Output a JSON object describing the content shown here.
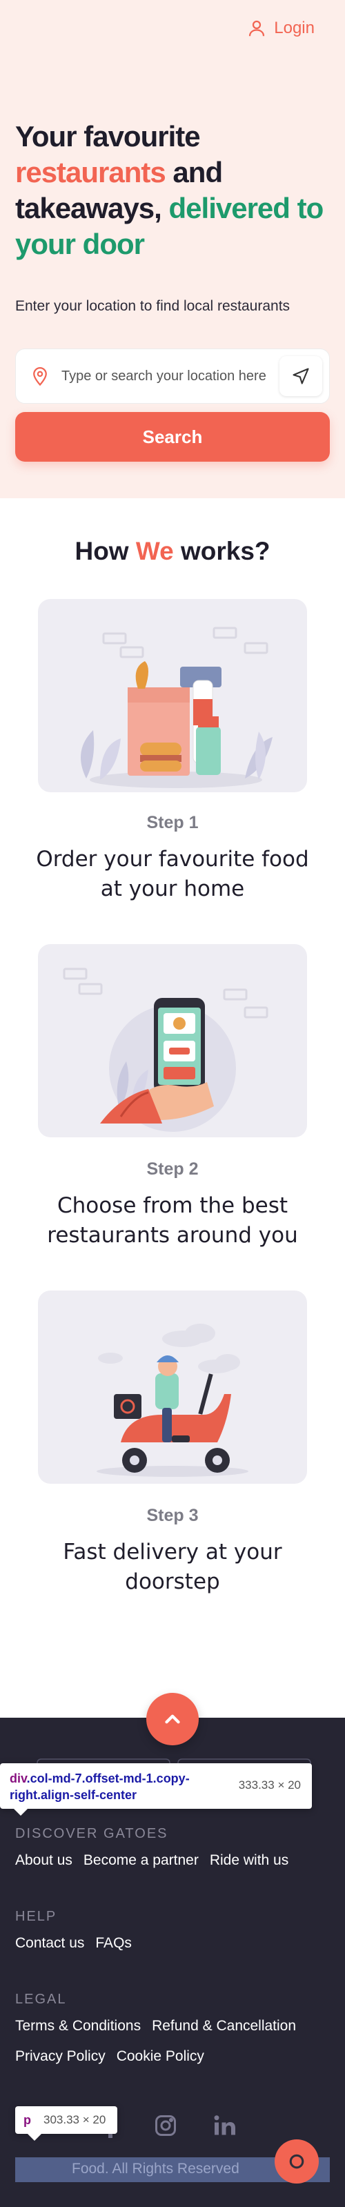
{
  "header": {
    "login_label": "Login"
  },
  "hero": {
    "title_part1": "Your favourite ",
    "title_part2": "restaurants",
    "title_part3": " and takeaways, ",
    "title_part4": "delivered to your door",
    "subtitle": "Enter your location to find local restaurants",
    "search_placeholder": "Type or search your location here",
    "search_button": "Search"
  },
  "how": {
    "title_part1": "How ",
    "title_part2": "We",
    "title_part3": " works?",
    "steps": [
      {
        "number": "Step 1",
        "text": "Order your favourite food at your home"
      },
      {
        "number": "Step 2",
        "text": "Choose from the best restaurants around you"
      },
      {
        "number": "Step 3",
        "text": "Fast delivery at your doorstep"
      }
    ]
  },
  "footer": {
    "discover_heading": "DISCOVER GATOES",
    "discover_links": [
      "About us",
      "Become a partner",
      "Ride with us"
    ],
    "help_heading": "HELP",
    "help_links": [
      "Contact us",
      "FAQs"
    ],
    "legal_heading": "LEGAL",
    "legal_links_row1": [
      "Terms & Conditions",
      "Refund & Cancellation"
    ],
    "legal_links_row2": [
      "Privacy Policy",
      "Cookie Policy"
    ],
    "copyright": "Food. All Rights Reserved"
  },
  "devtools": {
    "tooltip1_selector_tag": "div",
    "tooltip1_selector_class": ".col-md-7.offset-md-1.copy-right.align-self-center",
    "tooltip1_dims": "333.33 × 20",
    "tooltip2_tag": "p",
    "tooltip2_dims": "303.33 × 20"
  },
  "colors": {
    "accent": "#f26452",
    "green": "#1d9a6c",
    "hero_bg": "#fdeeea",
    "footer_bg": "#262533"
  }
}
